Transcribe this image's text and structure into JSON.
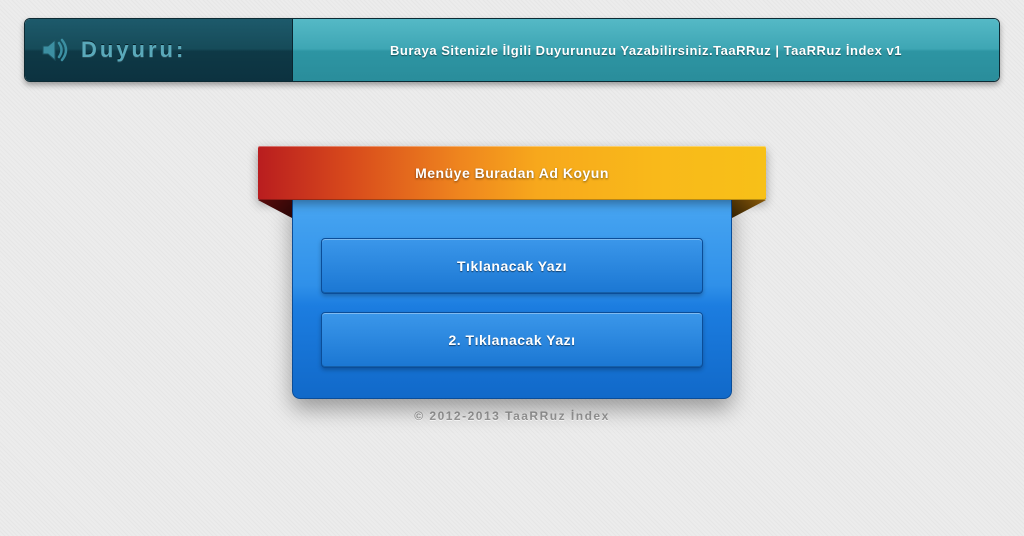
{
  "header": {
    "label": "Duyuru:",
    "announcement": "Buraya Sitenizle İlgili Duyurunuzu Yazabilirsiniz.TaaRRuz | TaaRRuz İndex v1"
  },
  "menu": {
    "title": "Menüye Buradan Ad Koyun",
    "items": [
      {
        "label": "Tıklanacak Yazı"
      },
      {
        "label": "2. Tıklanacak Yazı"
      }
    ]
  },
  "footer": {
    "text": "© 2012-2013 TaaRRuz İndex"
  }
}
